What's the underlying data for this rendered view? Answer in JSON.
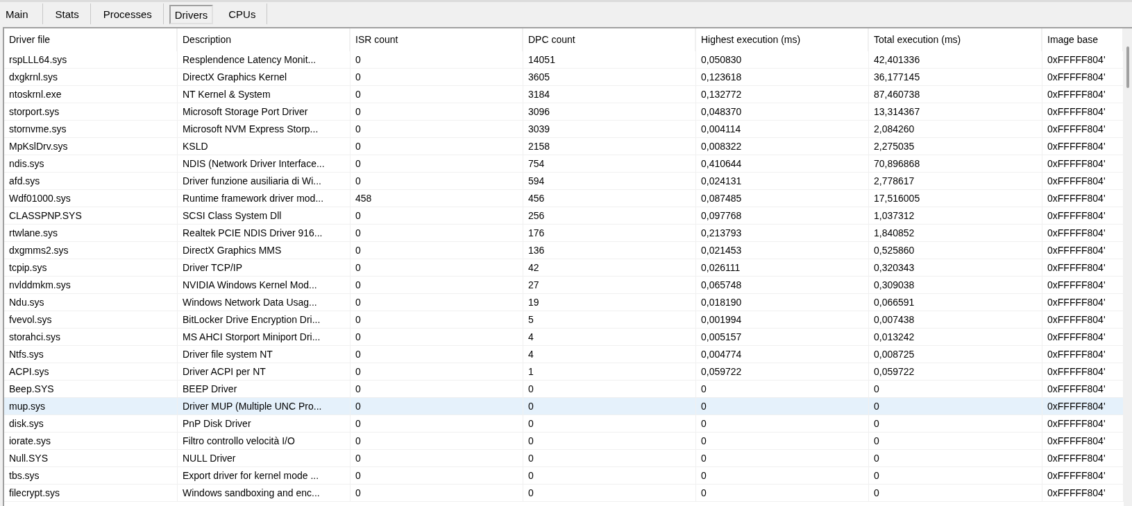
{
  "tabs": [
    {
      "label": "Main",
      "selected": false
    },
    {
      "label": "Stats",
      "selected": false
    },
    {
      "label": "Processes",
      "selected": false
    },
    {
      "label": "Drivers",
      "selected": true
    },
    {
      "label": "CPUs",
      "selected": false
    }
  ],
  "table": {
    "columns": [
      "Driver file",
      "Description",
      "ISR count",
      "DPC count",
      "Highest execution (ms)",
      "Total execution (ms)",
      "Image base"
    ],
    "rows": [
      {
        "cells": [
          "rspLLL64.sys",
          "Resplendence Latency Monit...",
          "0",
          "14051",
          "0,050830",
          "42,401336",
          "0xFFFFF804'"
        ],
        "selected": false
      },
      {
        "cells": [
          "dxgkrnl.sys",
          "DirectX Graphics Kernel",
          "0",
          "3605",
          "0,123618",
          "36,177145",
          "0xFFFFF804'"
        ],
        "selected": false
      },
      {
        "cells": [
          "ntoskrnl.exe",
          "NT Kernel & System",
          "0",
          "3184",
          "0,132772",
          "87,460738",
          "0xFFFFF804'"
        ],
        "selected": false
      },
      {
        "cells": [
          "storport.sys",
          "Microsoft Storage Port Driver",
          "0",
          "3096",
          "0,048370",
          "13,314367",
          "0xFFFFF804'"
        ],
        "selected": false
      },
      {
        "cells": [
          "stornvme.sys",
          "Microsoft NVM Express Storp...",
          "0",
          "3039",
          "0,004114",
          "2,084260",
          "0xFFFFF804'"
        ],
        "selected": false
      },
      {
        "cells": [
          "MpKslDrv.sys",
          "KSLD",
          "0",
          "2158",
          "0,008322",
          "2,275035",
          "0xFFFFF804'"
        ],
        "selected": false
      },
      {
        "cells": [
          "ndis.sys",
          "NDIS (Network Driver Interface...",
          "0",
          "754",
          "0,410644",
          "70,896868",
          "0xFFFFF804'"
        ],
        "selected": false
      },
      {
        "cells": [
          "afd.sys",
          "Driver funzione ausiliaria di Wi...",
          "0",
          "594",
          "0,024131",
          "2,778617",
          "0xFFFFF804'"
        ],
        "selected": false
      },
      {
        "cells": [
          "Wdf01000.sys",
          "Runtime framework driver mod...",
          "458",
          "456",
          "0,087485",
          "17,516005",
          "0xFFFFF804'"
        ],
        "selected": false
      },
      {
        "cells": [
          "CLASSPNP.SYS",
          "SCSI Class System Dll",
          "0",
          "256",
          "0,097768",
          "1,037312",
          "0xFFFFF804'"
        ],
        "selected": false
      },
      {
        "cells": [
          "rtwlane.sys",
          "Realtek PCIE NDIS Driver 916...",
          "0",
          "176",
          "0,213793",
          "1,840852",
          "0xFFFFF804'"
        ],
        "selected": false
      },
      {
        "cells": [
          "dxgmms2.sys",
          "DirectX Graphics MMS",
          "0",
          "136",
          "0,021453",
          "0,525860",
          "0xFFFFF804'"
        ],
        "selected": false
      },
      {
        "cells": [
          "tcpip.sys",
          "Driver TCP/IP",
          "0",
          "42",
          "0,026111",
          "0,320343",
          "0xFFFFF804'"
        ],
        "selected": false
      },
      {
        "cells": [
          "nvlddmkm.sys",
          "NVIDIA Windows Kernel Mod...",
          "0",
          "27",
          "0,065748",
          "0,309038",
          "0xFFFFF804'"
        ],
        "selected": false
      },
      {
        "cells": [
          "Ndu.sys",
          "Windows Network Data Usag...",
          "0",
          "19",
          "0,018190",
          "0,066591",
          "0xFFFFF804'"
        ],
        "selected": false
      },
      {
        "cells": [
          "fvevol.sys",
          "BitLocker Drive Encryption Dri...",
          "0",
          "5",
          "0,001994",
          "0,007438",
          "0xFFFFF804'"
        ],
        "selected": false
      },
      {
        "cells": [
          "storahci.sys",
          "MS AHCI Storport Miniport Dri...",
          "0",
          "4",
          "0,005157",
          "0,013242",
          "0xFFFFF804'"
        ],
        "selected": false
      },
      {
        "cells": [
          "Ntfs.sys",
          "Driver file system NT",
          "0",
          "4",
          "0,004774",
          "0,008725",
          "0xFFFFF804'"
        ],
        "selected": false
      },
      {
        "cells": [
          "ACPI.sys",
          "Driver ACPI per NT",
          "0",
          "1",
          "0,059722",
          "0,059722",
          "0xFFFFF804'"
        ],
        "selected": false
      },
      {
        "cells": [
          "Beep.SYS",
          "BEEP Driver",
          "0",
          "0",
          "0",
          "0",
          "0xFFFFF804'"
        ],
        "selected": false
      },
      {
        "cells": [
          "mup.sys",
          "Driver MUP (Multiple UNC Pro...",
          "0",
          "0",
          "0",
          "0",
          "0xFFFFF804'"
        ],
        "selected": true
      },
      {
        "cells": [
          "disk.sys",
          "PnP Disk Driver",
          "0",
          "0",
          "0",
          "0",
          "0xFFFFF804'"
        ],
        "selected": false
      },
      {
        "cells": [
          "iorate.sys",
          "Filtro controllo velocità I/O",
          "0",
          "0",
          "0",
          "0",
          "0xFFFFF804'"
        ],
        "selected": false
      },
      {
        "cells": [
          "Null.SYS",
          "NULL Driver",
          "0",
          "0",
          "0",
          "0",
          "0xFFFFF804'"
        ],
        "selected": false
      },
      {
        "cells": [
          "tbs.sys",
          "Export driver for kernel mode ...",
          "0",
          "0",
          "0",
          "0",
          "0xFFFFF804'"
        ],
        "selected": false
      },
      {
        "cells": [
          "filecrypt.sys",
          "Windows sandboxing and enc...",
          "0",
          "0",
          "0",
          "0",
          "0xFFFFF804'"
        ],
        "selected": false
      }
    ]
  }
}
